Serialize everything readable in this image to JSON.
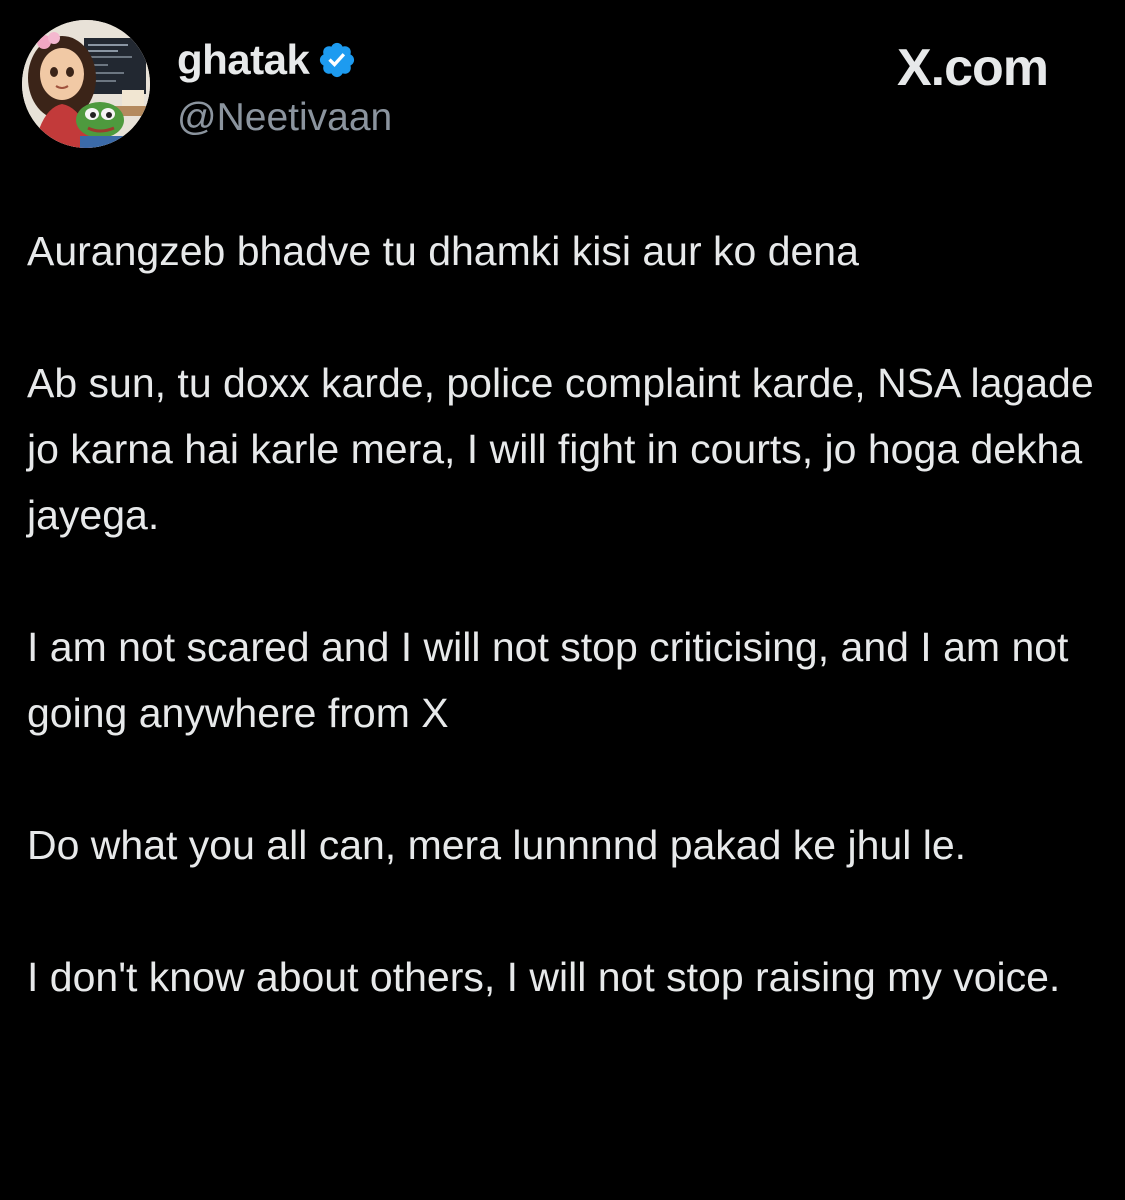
{
  "author": {
    "display_name": "ghatak",
    "handle": "@Neetivaan",
    "avatar_icon": "profile-avatar-illustration",
    "verified_icon": "verified-badge-icon",
    "verified_color": "#1d9bf0"
  },
  "brand": {
    "label": "X.com"
  },
  "tweet": {
    "paragraphs": [
      "Aurangzeb bhadve tu dhamki kisi aur ko dena",
      "Ab sun, tu doxx karde, police complaint karde, NSA lagade jo karna hai karle mera, I will fight in courts, jo hoga dekha jayega.",
      "I am not scared and I will not stop criticising, and I am not going anywhere from X",
      "Do what you all can, mera lunnnnd pakad ke jhul le.",
      "I don't know about others, I will not stop raising my voice."
    ]
  },
  "colors": {
    "background": "#000000",
    "text_primary": "#e7e9ea",
    "text_secondary": "#8b949e"
  }
}
